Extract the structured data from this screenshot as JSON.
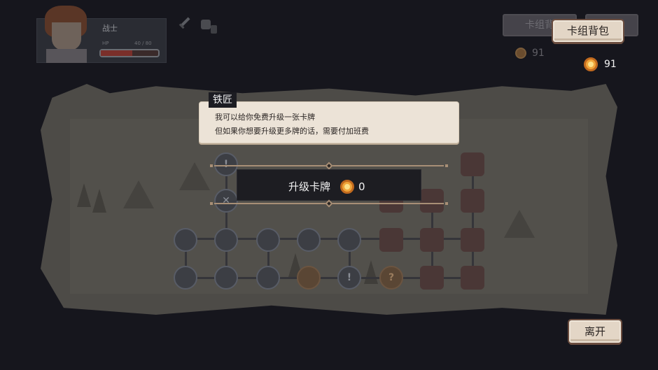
{
  "hero": {
    "name": "战士",
    "hp_label": "HP",
    "hp_text": "40 / 80",
    "hp_fraction": 0.55
  },
  "top_right": {
    "ghost_button_1": "卡组背",
    "ghost_gold_value": "91",
    "deck_button_label": "卡组背包",
    "gold_value": "91"
  },
  "dialog": {
    "speaker": "铁匠",
    "lines": [
      "我可以给你免费升级一张卡牌",
      "但如果你想要升级更多牌的话，需要付加班费"
    ]
  },
  "upgrade": {
    "label": "升级卡牌",
    "cost": "0"
  },
  "leave_button_label": "离开",
  "map": {
    "node_symbols": [
      "!",
      "✕",
      "?",
      "!"
    ]
  },
  "colors": {
    "background": "#16161d",
    "panel_paper": "#ece3d7",
    "button_border": "#6b4d3f",
    "coin": "#f0a53a",
    "hp_bar": "#7a2f2a"
  },
  "icons": [
    "sword-icon",
    "bag-icon",
    "coin-icon",
    "map-node-icons"
  ]
}
